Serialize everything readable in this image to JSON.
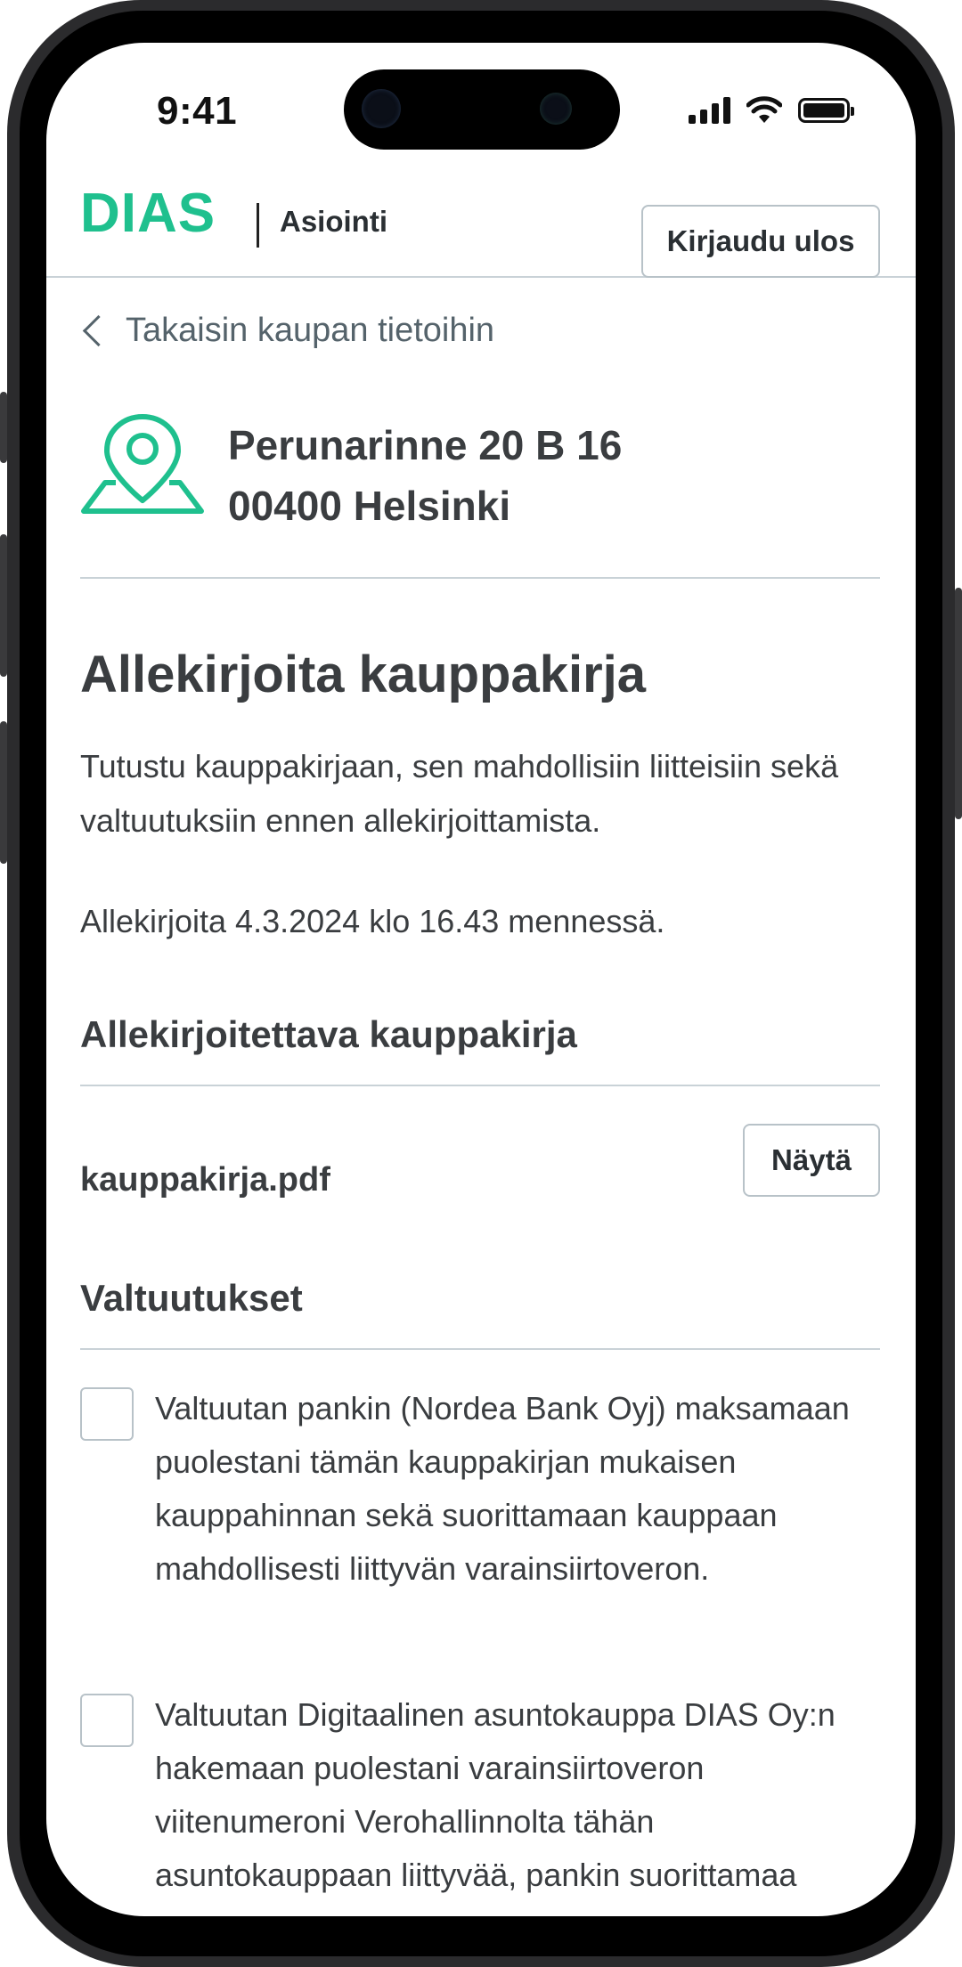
{
  "status_bar": {
    "time": "9:41"
  },
  "header": {
    "logo": "DIAS",
    "service_name": "Asiointi",
    "logout_label": "Kirjaudu ulos"
  },
  "back_link": "Takaisin kaupan tietoihin",
  "address": {
    "street": "Perunarinne 20 B 16",
    "city": "00400 Helsinki"
  },
  "main": {
    "title": "Allekirjoita kauppakirja",
    "intro": "Tutustu kauppakirjaan, sen mahdollisiin liitteisiin sekä valtuutuksiin ennen allekirjoittamista.",
    "deadline": "Allekirjoita 4.3.2024 klo 16.43 mennessä."
  },
  "document_section": {
    "title": "Allekirjoitettava kauppakirja",
    "file_name": "kauppakirja.pdf",
    "show_label": "Näytä"
  },
  "authorizations": {
    "title": "Valtuutukset",
    "items": [
      {
        "text": "Valtuutan pankin (Nordea Bank Oyj) maksamaan puolestani tämän kauppakirjan mukaisen kauppahinnan sekä suorittamaan kauppaan mahdollisesti liittyvän varainsiirtoveron.",
        "checked": false
      },
      {
        "text": "Valtuutan Digitaalinen asuntokauppa DIAS Oy:n hakemaan puolestani varainsiirtoveron viitenumeroni Verohallinnolta tähän asuntokauppaan liittyvää, pankin suorittamaa",
        "checked": false
      }
    ]
  },
  "colors": {
    "brand": "#1fc08e",
    "text": "#3a3d40",
    "border": "#c9d2d7"
  }
}
